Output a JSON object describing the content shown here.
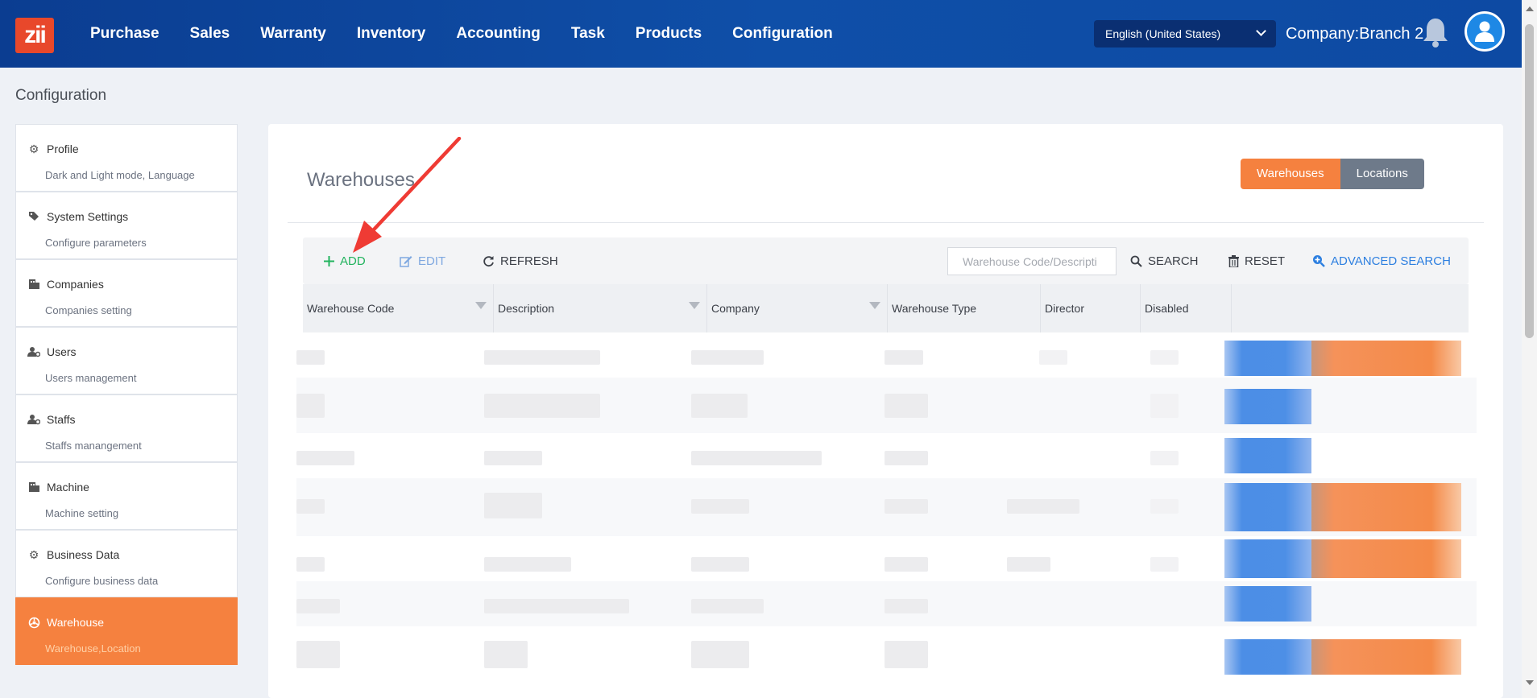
{
  "app": {
    "logo_text": "zii"
  },
  "nav": {
    "items": [
      "Purchase",
      "Sales",
      "Warranty",
      "Inventory",
      "Accounting",
      "Task",
      "Products",
      "Configuration"
    ]
  },
  "header": {
    "language": "English (United States)",
    "company": "Company:Branch 2"
  },
  "page": {
    "heading": "Configuration"
  },
  "sidebar": {
    "items": [
      {
        "title": "Profile",
        "sub": "Dark and Light mode, Language",
        "icon": "gear-icon"
      },
      {
        "title": "System Settings",
        "sub": "Configure parameters",
        "icon": "tags-icon"
      },
      {
        "title": "Companies",
        "sub": "Companies setting",
        "icon": "building-icon"
      },
      {
        "title": "Users",
        "sub": "Users management",
        "icon": "user-cog-icon"
      },
      {
        "title": "Staffs",
        "sub": "Staffs manangement",
        "icon": "user-cog-icon"
      },
      {
        "title": "Machine",
        "sub": "Machine setting",
        "icon": "building-icon"
      },
      {
        "title": "Business Data",
        "sub": "Configure business data",
        "icon": "gear-icon"
      },
      {
        "title": "Warehouse",
        "sub": "Warehouse,Location",
        "icon": "warehouse-icon",
        "active": true
      }
    ]
  },
  "main": {
    "title": "Warehouses",
    "toggle": {
      "on": "Warehouses",
      "off": "Locations"
    },
    "toolbar": {
      "add": "ADD",
      "edit": "EDIT",
      "refresh": "REFRESH",
      "search_placeholder": "Warehouse Code/Descripti",
      "search": "SEARCH",
      "reset": "RESET",
      "advanced": "ADVANCED SEARCH"
    },
    "columns": [
      "Warehouse Code",
      "Description",
      "Company",
      "Warehouse Type",
      "Director",
      "Disabled"
    ]
  },
  "colors": {
    "accent": "#f5813f",
    "primary": "#0f4fa8",
    "add": "#22b35e",
    "link": "#2d7fe0"
  }
}
